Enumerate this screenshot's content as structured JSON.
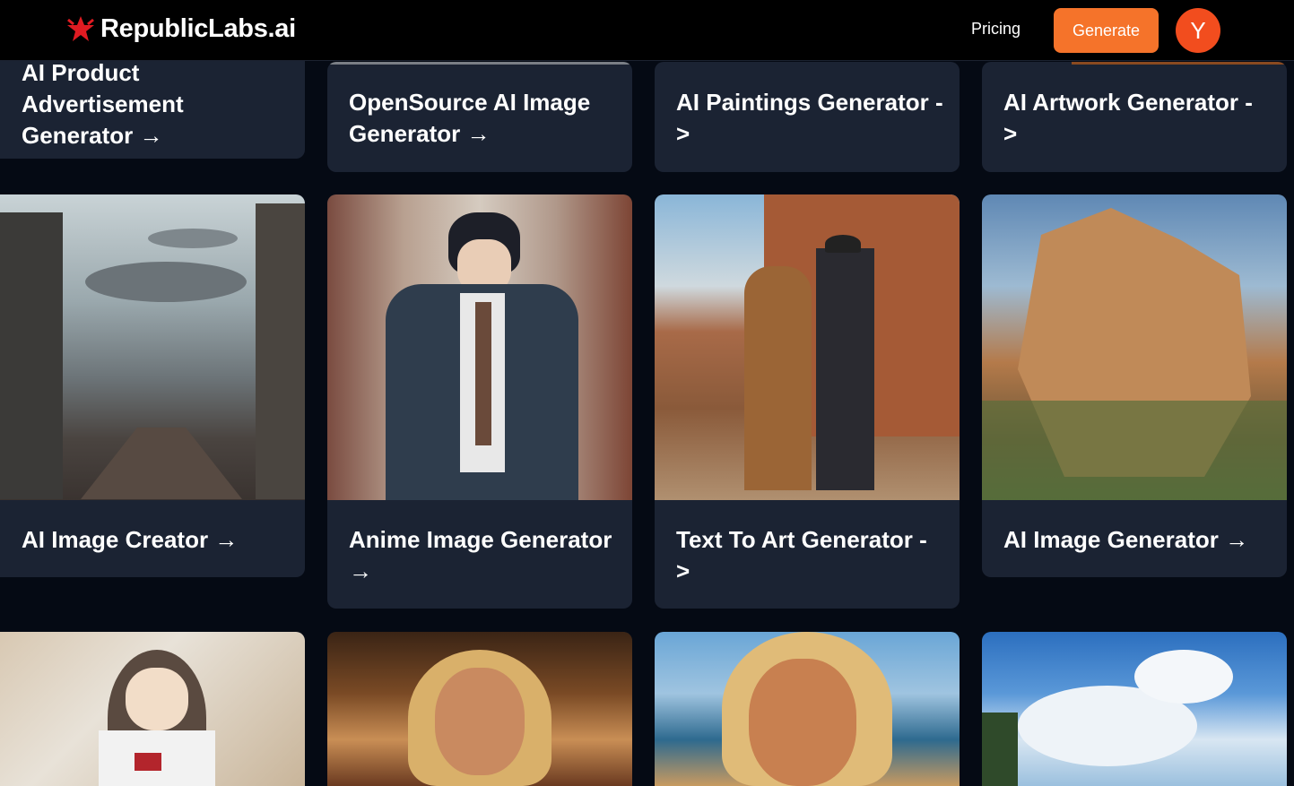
{
  "header": {
    "logo_text": "RepublicLabs.ai",
    "pricing_label": "Pricing",
    "generate_label": "Generate",
    "avatar_letter": "Y"
  },
  "row1": [
    {
      "title": "AI Product Advertisement Generator →"
    },
    {
      "title": "OpenSource AI Image Generator →"
    },
    {
      "title": "AI Paintings Generator - >"
    },
    {
      "title": "AI Artwork Generator - >"
    }
  ],
  "row2": [
    {
      "title": "AI Image Creator →",
      "image": "futuristic-city"
    },
    {
      "title": "Anime Image Generator →",
      "image": "anime-character"
    },
    {
      "title": "Text To Art Generator - >",
      "image": "western-couple"
    },
    {
      "title": "AI Image Generator →",
      "image": "modular-building"
    }
  ],
  "row3": [
    {
      "image": "anime-girl"
    },
    {
      "image": "woman-bar"
    },
    {
      "image": "woman-beach"
    },
    {
      "image": "sky-palm"
    }
  ],
  "colors": {
    "accent": "#f5732a",
    "avatar": "#f24d1e",
    "card": "#1b2333",
    "background": "#050a14"
  }
}
